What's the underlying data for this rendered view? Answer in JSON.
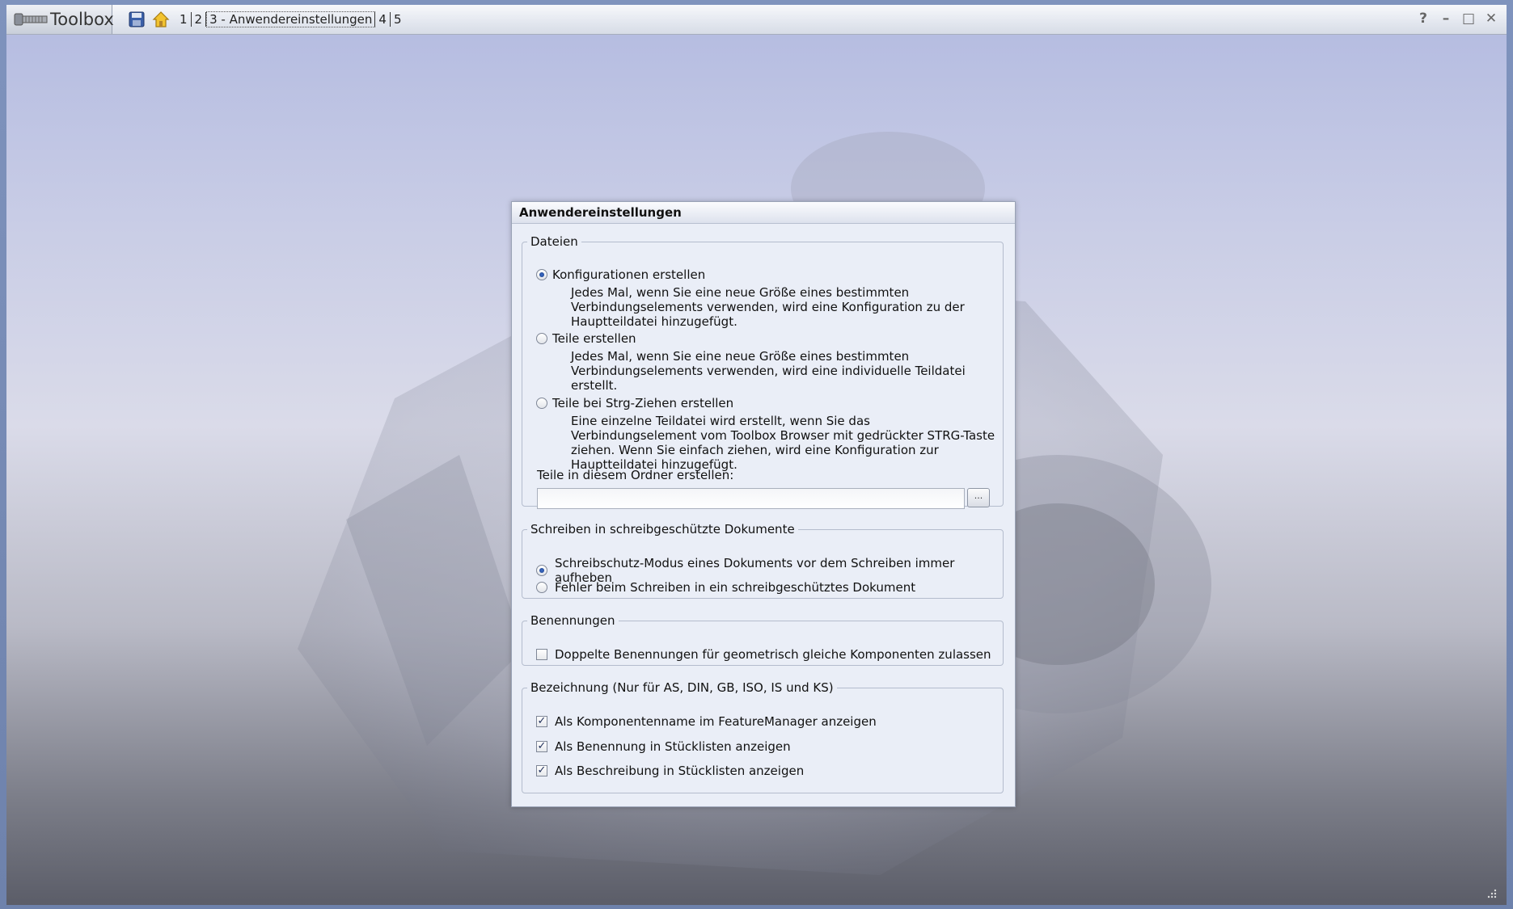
{
  "app": {
    "title": "Toolbox"
  },
  "toolbar": {
    "breadcrumbs": [
      "1",
      "2",
      "3 - Anwendereinstellungen",
      "4",
      "5"
    ],
    "icons": [
      "save-icon",
      "home-icon"
    ]
  },
  "window_controls": {
    "help": "?",
    "minimize": "–",
    "maximize": "□",
    "close": "✕"
  },
  "dialog": {
    "title": "Anwendereinstellungen",
    "files": {
      "legend": "Dateien",
      "opt_configs": {
        "label": "Konfigurationen erstellen",
        "desc": "Jedes Mal, wenn Sie eine neue Größe eines bestimmten Verbindungselements verwenden, wird eine Konfiguration zu der Hauptteildatei hinzugefügt.",
        "selected": true
      },
      "opt_parts": {
        "label": "Teile erstellen",
        "desc": "Jedes Mal, wenn Sie eine neue Größe eines bestimmten Verbindungselements verwenden, wird eine individuelle Teildatei erstellt.",
        "selected": false
      },
      "opt_ctrl": {
        "label": "Teile bei Strg-Ziehen erstellen",
        "desc": "Eine einzelne Teildatei wird erstellt, wenn Sie das Verbindungselement vom Toolbox Browser mit gedrückter STRG-Taste ziehen. Wenn Sie einfach ziehen, wird eine Konfiguration zur Hauptteildatei hinzugefügt.",
        "selected": false
      },
      "folder_label": "Teile in diesem Ordner erstellen:",
      "folder_value": "",
      "browse_label": "..."
    },
    "readonly": {
      "legend": "Schreiben in schreibgeschützte Dokumente",
      "opt_remove": {
        "label": "Schreibschutz-Modus eines Dokuments vor dem Schreiben immer aufheben",
        "selected": true
      },
      "opt_error": {
        "label": "Fehler beim Schreiben in ein schreibgeschütztes Dokument",
        "selected": false
      }
    },
    "naming": {
      "legend": "Benennungen",
      "opt_duplicate": {
        "label": "Doppelte Benennungen für geometrisch gleiche Komponenten zulassen",
        "checked": false
      }
    },
    "designation": {
      "legend": "Bezeichnung (Nur für AS, DIN, GB, ISO, IS und KS)",
      "opt_component": {
        "label": "Als Komponentenname im FeatureManager anzeigen",
        "checked": true
      },
      "opt_bom_name": {
        "label": "Als Benennung in Stücklisten anzeigen",
        "checked": true
      },
      "opt_bom_desc": {
        "label": "Als Beschreibung in Stücklisten anzeigen",
        "checked": true
      }
    }
  }
}
